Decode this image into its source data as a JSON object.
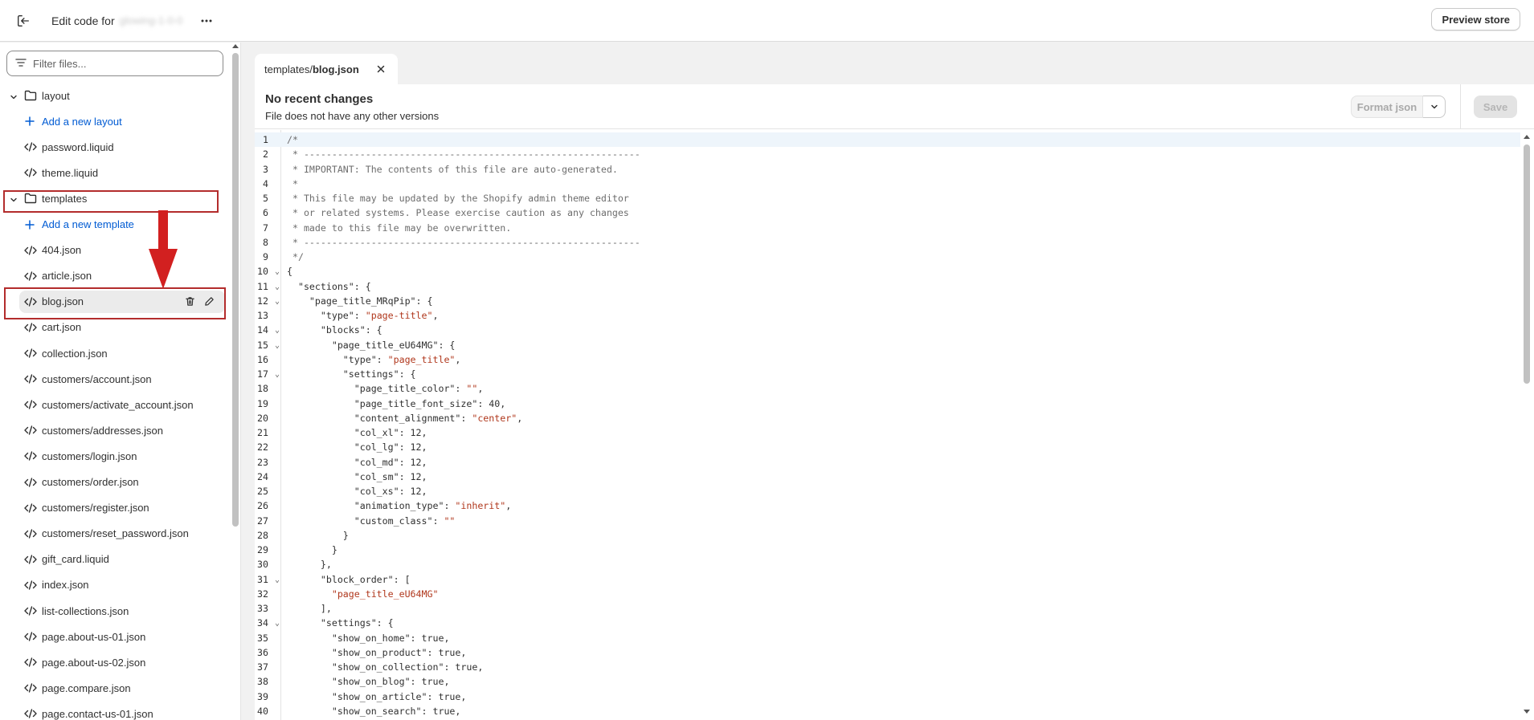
{
  "header": {
    "exit_icon": "exit-icon",
    "title_prefix": "Edit code for",
    "theme_name": "glowing-1-0-0",
    "more_icon": "more-horizontal-icon",
    "preview_label": "Preview store"
  },
  "sidebar": {
    "filter_placeholder": "Filter files...",
    "items": [
      {
        "type": "folder",
        "label": "layout"
      },
      {
        "type": "add",
        "label": "Add a new layout"
      },
      {
        "type": "file",
        "label": "password.liquid"
      },
      {
        "type": "file",
        "label": "theme.liquid"
      },
      {
        "type": "folder",
        "label": "templates"
      },
      {
        "type": "add",
        "label": "Add a new template"
      },
      {
        "type": "file",
        "label": "404.json"
      },
      {
        "type": "file",
        "label": "article.json"
      },
      {
        "type": "file",
        "label": "blog.json",
        "selected": true
      },
      {
        "type": "file",
        "label": "cart.json"
      },
      {
        "type": "file",
        "label": "collection.json"
      },
      {
        "type": "file",
        "label": "customers/account.json"
      },
      {
        "type": "file",
        "label": "customers/activate_account.json"
      },
      {
        "type": "file",
        "label": "customers/addresses.json"
      },
      {
        "type": "file",
        "label": "customers/login.json"
      },
      {
        "type": "file",
        "label": "customers/order.json"
      },
      {
        "type": "file",
        "label": "customers/register.json"
      },
      {
        "type": "file",
        "label": "customers/reset_password.json"
      },
      {
        "type": "file",
        "label": "gift_card.liquid"
      },
      {
        "type": "file",
        "label": "index.json"
      },
      {
        "type": "file",
        "label": "list-collections.json"
      },
      {
        "type": "file",
        "label": "page.about-us-01.json"
      },
      {
        "type": "file",
        "label": "page.about-us-02.json"
      },
      {
        "type": "file",
        "label": "page.compare.json"
      },
      {
        "type": "file",
        "label": "page.contact-us-01.json"
      }
    ]
  },
  "tab": {
    "path": "templates/",
    "filename": "blog.json"
  },
  "editor": {
    "status_title": "No recent changes",
    "status_subtitle": "File does not have any other versions",
    "format_label": "Format json",
    "save_label": "Save",
    "colors": {
      "string": "#b0371c",
      "comment": "#6d6d6d",
      "link": "#005bd3",
      "highlight": "#b32c2c"
    },
    "lines": [
      {
        "n": "1",
        "fold": false,
        "parts": [
          [
            "com",
            "/*"
          ]
        ]
      },
      {
        "n": "2",
        "fold": false,
        "parts": [
          [
            "com",
            " * ------------------------------------------------------------"
          ]
        ]
      },
      {
        "n": "3",
        "fold": false,
        "parts": [
          [
            "com",
            " * IMPORTANT: The contents of this file are auto-generated."
          ]
        ]
      },
      {
        "n": "4",
        "fold": false,
        "parts": [
          [
            "com",
            " *"
          ]
        ]
      },
      {
        "n": "5",
        "fold": false,
        "parts": [
          [
            "com",
            " * This file may be updated by the Shopify admin theme editor"
          ]
        ]
      },
      {
        "n": "6",
        "fold": false,
        "parts": [
          [
            "com",
            " * or related systems. Please exercise caution as any changes"
          ]
        ]
      },
      {
        "n": "7",
        "fold": false,
        "parts": [
          [
            "com",
            " * made to this file may be overwritten."
          ]
        ]
      },
      {
        "n": "8",
        "fold": false,
        "parts": [
          [
            "com",
            " * ------------------------------------------------------------"
          ]
        ]
      },
      {
        "n": "9",
        "fold": false,
        "parts": [
          [
            "com",
            " */"
          ]
        ]
      },
      {
        "n": "10",
        "fold": true,
        "parts": [
          [
            "key",
            "{"
          ]
        ]
      },
      {
        "n": "11",
        "fold": true,
        "parts": [
          [
            "key",
            "  \"sections\": {"
          ]
        ]
      },
      {
        "n": "12",
        "fold": true,
        "parts": [
          [
            "key",
            "    \"page_title_MRqPip\": {"
          ]
        ]
      },
      {
        "n": "13",
        "fold": false,
        "parts": [
          [
            "key",
            "      \"type\": "
          ],
          [
            "str",
            "\"page-title\""
          ],
          [
            "key",
            ","
          ]
        ]
      },
      {
        "n": "14",
        "fold": true,
        "parts": [
          [
            "key",
            "      \"blocks\": {"
          ]
        ]
      },
      {
        "n": "15",
        "fold": true,
        "parts": [
          [
            "key",
            "        \"page_title_eU64MG\": {"
          ]
        ]
      },
      {
        "n": "16",
        "fold": false,
        "parts": [
          [
            "key",
            "          \"type\": "
          ],
          [
            "str",
            "\"page_title\""
          ],
          [
            "key",
            ","
          ]
        ]
      },
      {
        "n": "17",
        "fold": true,
        "parts": [
          [
            "key",
            "          \"settings\": {"
          ]
        ]
      },
      {
        "n": "18",
        "fold": false,
        "parts": [
          [
            "key",
            "            \"page_title_color\": "
          ],
          [
            "str",
            "\"\""
          ],
          [
            "key",
            ","
          ]
        ]
      },
      {
        "n": "19",
        "fold": false,
        "parts": [
          [
            "key",
            "            \"page_title_font_size\": 40,"
          ]
        ]
      },
      {
        "n": "20",
        "fold": false,
        "parts": [
          [
            "key",
            "            \"content_alignment\": "
          ],
          [
            "str",
            "\"center\""
          ],
          [
            "key",
            ","
          ]
        ]
      },
      {
        "n": "21",
        "fold": false,
        "parts": [
          [
            "key",
            "            \"col_xl\": 12,"
          ]
        ]
      },
      {
        "n": "22",
        "fold": false,
        "parts": [
          [
            "key",
            "            \"col_lg\": 12,"
          ]
        ]
      },
      {
        "n": "23",
        "fold": false,
        "parts": [
          [
            "key",
            "            \"col_md\": 12,"
          ]
        ]
      },
      {
        "n": "24",
        "fold": false,
        "parts": [
          [
            "key",
            "            \"col_sm\": 12,"
          ]
        ]
      },
      {
        "n": "25",
        "fold": false,
        "parts": [
          [
            "key",
            "            \"col_xs\": 12,"
          ]
        ]
      },
      {
        "n": "26",
        "fold": false,
        "parts": [
          [
            "key",
            "            \"animation_type\": "
          ],
          [
            "str",
            "\"inherit\""
          ],
          [
            "key",
            ","
          ]
        ]
      },
      {
        "n": "27",
        "fold": false,
        "parts": [
          [
            "key",
            "            \"custom_class\": "
          ],
          [
            "str",
            "\"\""
          ]
        ]
      },
      {
        "n": "28",
        "fold": false,
        "parts": [
          [
            "key",
            "          }"
          ]
        ]
      },
      {
        "n": "29",
        "fold": false,
        "parts": [
          [
            "key",
            "        }"
          ]
        ]
      },
      {
        "n": "30",
        "fold": false,
        "parts": [
          [
            "key",
            "      },"
          ]
        ]
      },
      {
        "n": "31",
        "fold": true,
        "parts": [
          [
            "key",
            "      \"block_order\": ["
          ]
        ]
      },
      {
        "n": "32",
        "fold": false,
        "parts": [
          [
            "str",
            "        \"page_title_eU64MG\""
          ]
        ]
      },
      {
        "n": "33",
        "fold": false,
        "parts": [
          [
            "key",
            "      ],"
          ]
        ]
      },
      {
        "n": "34",
        "fold": true,
        "parts": [
          [
            "key",
            "      \"settings\": {"
          ]
        ]
      },
      {
        "n": "35",
        "fold": false,
        "parts": [
          [
            "key",
            "        \"show_on_home\": true,"
          ]
        ]
      },
      {
        "n": "36",
        "fold": false,
        "parts": [
          [
            "key",
            "        \"show_on_product\": true,"
          ]
        ]
      },
      {
        "n": "37",
        "fold": false,
        "parts": [
          [
            "key",
            "        \"show_on_collection\": true,"
          ]
        ]
      },
      {
        "n": "38",
        "fold": false,
        "parts": [
          [
            "key",
            "        \"show_on_blog\": true,"
          ]
        ]
      },
      {
        "n": "39",
        "fold": false,
        "parts": [
          [
            "key",
            "        \"show_on_article\": true,"
          ]
        ]
      },
      {
        "n": "40",
        "fold": false,
        "parts": [
          [
            "key",
            "        \"show_on_search\": true,"
          ]
        ]
      }
    ]
  }
}
